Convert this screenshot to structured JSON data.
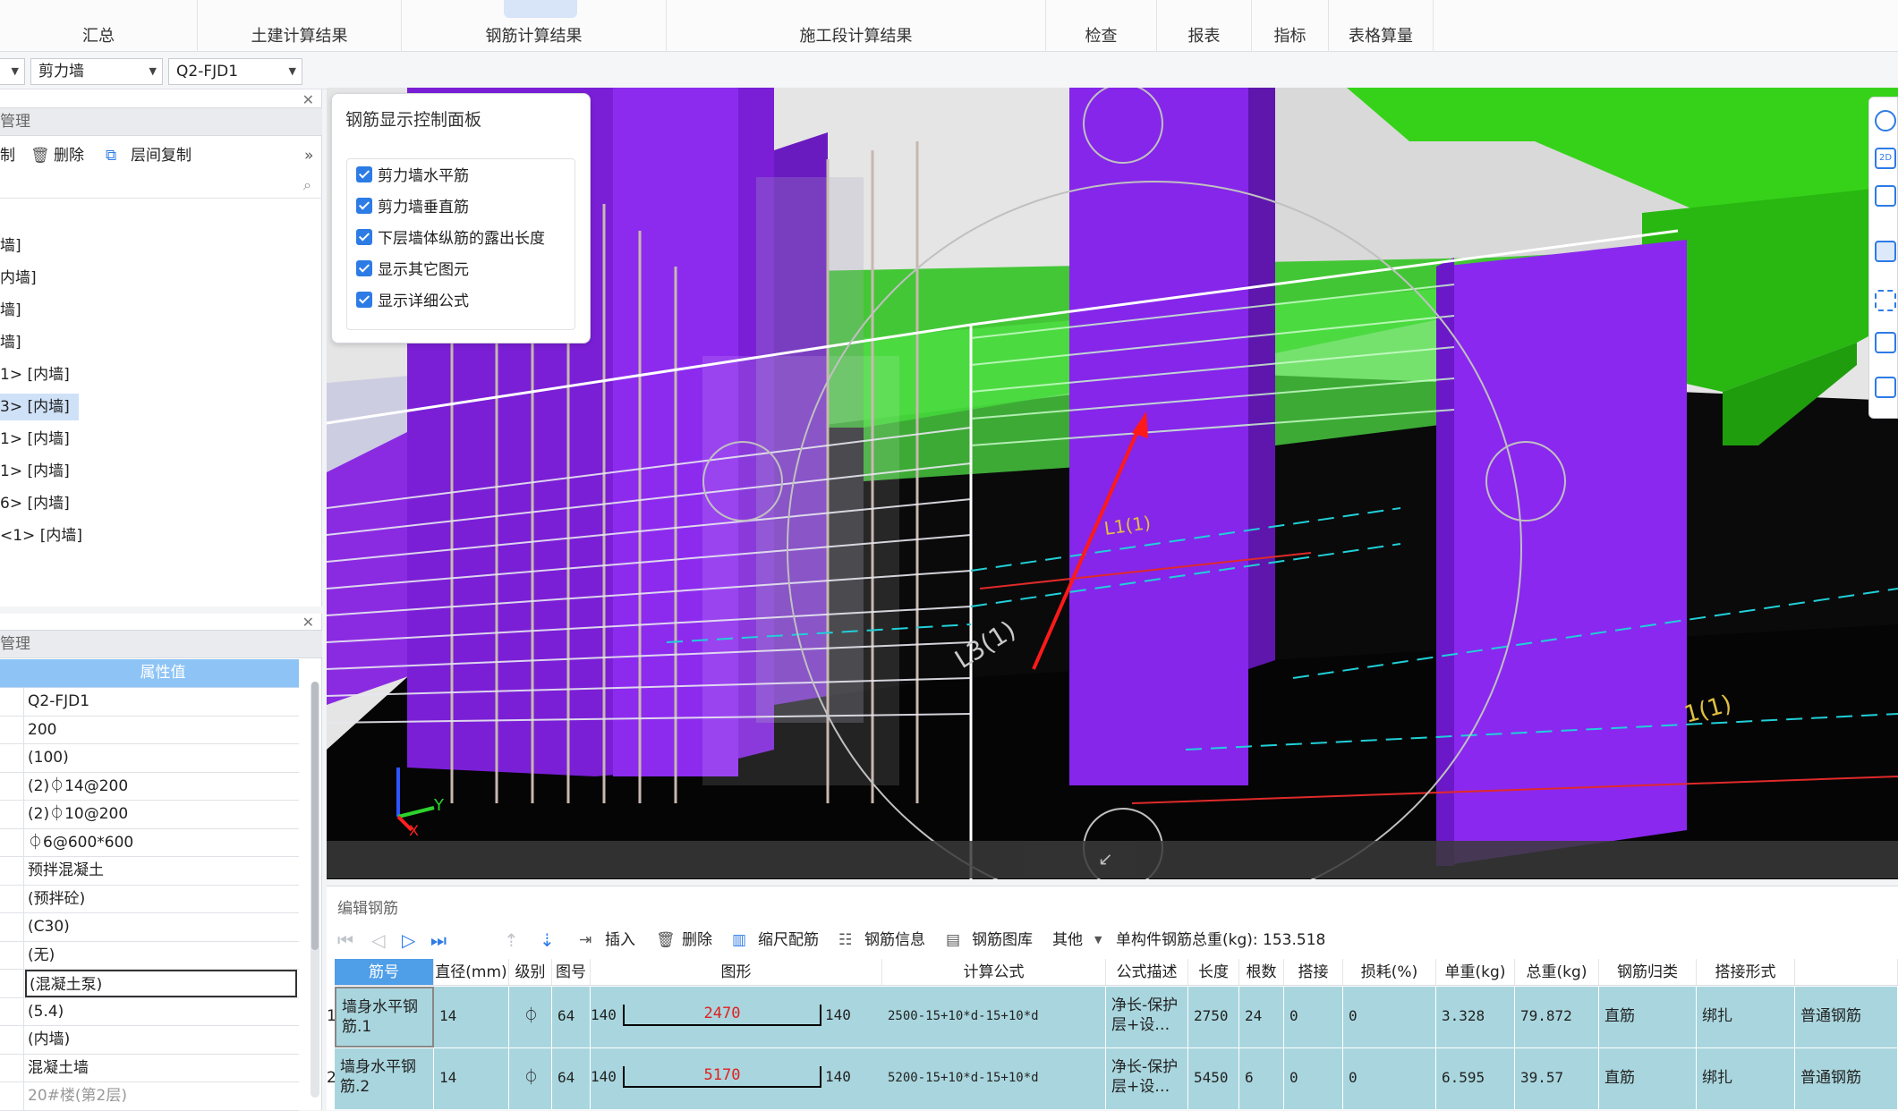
{
  "ribbon": {
    "tabs": [
      {
        "label": "汇总"
      },
      {
        "label": "土建计算结果"
      },
      {
        "label": "钢筋计算结果"
      },
      {
        "label": "施工段计算结果"
      },
      {
        "label": "检查"
      },
      {
        "label": "报表"
      },
      {
        "label": "指标"
      },
      {
        "label": "表格算量"
      }
    ]
  },
  "toolbar2": {
    "component_type": "剪力墙",
    "component_name": "Q2-FJD1"
  },
  "left_top": {
    "header": "管理",
    "actions": {
      "copy": "制",
      "delete": "删除",
      "floor_copy": "层间复制"
    },
    "tree": [
      {
        "label": "墙]"
      },
      {
        "label": "内墙]"
      },
      {
        "label": "墙]"
      },
      {
        "label": "墙]"
      },
      {
        "label": "1> [内墙]"
      },
      {
        "label": "3> [内墙]",
        "selected": true
      },
      {
        "label": "1> [内墙]"
      },
      {
        "label": "1> [内墙]"
      },
      {
        "label": "6> [内墙]"
      },
      {
        "label": "<1> [内墙]"
      }
    ]
  },
  "left_bottom": {
    "header": "管理",
    "column_header": "属性值",
    "properties": [
      {
        "value": "Q2-FJD1"
      },
      {
        "value": "200"
      },
      {
        "value": "(100)"
      },
      {
        "value": "(2)⏀14@200"
      },
      {
        "value": "(2)⏀10@200"
      },
      {
        "value": "⏀6@600*600"
      },
      {
        "value": "预拌混凝土"
      },
      {
        "value": "(预拌砼)"
      },
      {
        "value": "(C30)"
      },
      {
        "value": "(无)"
      },
      {
        "value": "(混凝土泵)",
        "editing": true
      },
      {
        "value": "(5.4)"
      },
      {
        "value": "(内墙)"
      },
      {
        "value": "混凝土墙"
      },
      {
        "value": "20#楼(第2层)",
        "muted": true
      }
    ]
  },
  "control_panel": {
    "title": "钢筋显示控制面板",
    "options": [
      {
        "label": "剪力墙水平筋",
        "checked": true
      },
      {
        "label": "剪力墙垂直筋",
        "checked": true
      },
      {
        "label": "下层墙体纵筋的露出长度",
        "checked": true
      },
      {
        "label": "显示其它图元",
        "checked": true
      },
      {
        "label": "显示详细公式",
        "checked": true
      }
    ]
  },
  "viewport": {
    "labels": [
      "1(1)",
      "L3(1)",
      "L1(1)"
    ]
  },
  "editor": {
    "title": "编辑钢筋",
    "toolbar": {
      "insert": "插入",
      "delete": "删除",
      "scale_rebar": "缩尺配筋",
      "rebar_info": "钢筋信息",
      "rebar_library": "钢筋图库",
      "other": "其他",
      "total_weight": "单构件钢筋总重(kg): 153.518"
    },
    "columns": [
      "筋号",
      "直径(mm)",
      "级别",
      "图号",
      "图形",
      "计算公式",
      "公式描述",
      "长度",
      "根数",
      "搭接",
      "损耗(%)",
      "单重(kg)",
      "总重(kg)",
      "钢筋归类",
      "搭接形式",
      ""
    ],
    "rows": [
      {
        "index": "1",
        "name": "墙身水平钢筋.1",
        "diameter": "14",
        "grade": "⏀",
        "fig_no": "64",
        "shape_left": "140",
        "shape_mid": "2470",
        "shape_right": "140",
        "formula": "2500-15+10*d-15+10*d",
        "desc": "净长-保护层+设…",
        "length": "2750",
        "count": "24",
        "lap": "0",
        "loss": "0",
        "unit_weight": "3.328",
        "total_weight": "79.872",
        "category": "直筋",
        "lap_type": "绑扎",
        "rebar_type": "普通钢筋"
      },
      {
        "index": "2",
        "name": "墙身水平钢筋.2",
        "diameter": "14",
        "grade": "⏀",
        "fig_no": "64",
        "shape_left": "140",
        "shape_mid": "5170",
        "shape_right": "140",
        "formula": "5200-15+10*d-15+10*d",
        "desc": "净长-保护层+设…",
        "length": "5450",
        "count": "6",
        "lap": "0",
        "loss": "0",
        "unit_weight": "6.595",
        "total_weight": "39.57",
        "category": "直筋",
        "lap_type": "绑扎",
        "rebar_type": "普通钢筋"
      }
    ]
  },
  "colors": {
    "accent": "#2d7be5",
    "wall_purple": "#7a1fd6",
    "beam_green": "#2fd21f",
    "row_highlight": "#a9d6de"
  }
}
